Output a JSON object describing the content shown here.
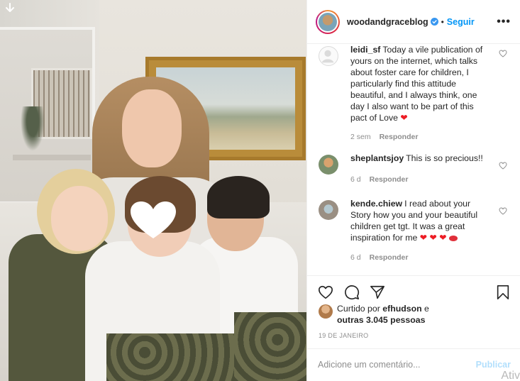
{
  "header": {
    "username": "woodandgraceblog",
    "separator": "•",
    "follow_label": "Seguir",
    "more_label": "•••"
  },
  "comments": [
    {
      "user": "leidi_sf",
      "text": "Today a vile publication of yours on the internet, which talks about foster care for children, I particularly find this attitude beautiful, and I always think, one day I also want to be part of this pact of Love",
      "emoji": "❤",
      "age": "2 sem",
      "reply_label": "Responder"
    },
    {
      "user": "sheplantsjoy",
      "text": "This is so precious!!",
      "emoji": "",
      "age": "6 d",
      "reply_label": "Responder"
    },
    {
      "user": "kende.chiew",
      "text": "I read about your Story how you and your beautiful children get tgt. It was a great inspiration for me",
      "emoji": "❤ ❤ ❤",
      "age": "6 d",
      "reply_label": "Responder"
    }
  ],
  "likes": {
    "prefix": "Curtido por",
    "user": "efhudson",
    "conjunction": "e",
    "others": "outras 3.045 pessoas"
  },
  "date": "19 DE JANEIRO",
  "add_comment": {
    "placeholder": "Adicione um comentário...",
    "publish_label": "Publicar"
  },
  "watermark": "Ativ",
  "icons": {
    "download": "download-arrow-icon",
    "verified": "verified-badge-icon",
    "like": "heart-outline-icon",
    "comment": "comment-bubble-icon",
    "share": "paper-plane-icon",
    "save": "bookmark-icon"
  },
  "colors": {
    "accent": "#0095f6",
    "publish_disabled": "#b2dffc",
    "meta_gray": "#8e8e8e",
    "heart_red": "#ed1c24"
  }
}
